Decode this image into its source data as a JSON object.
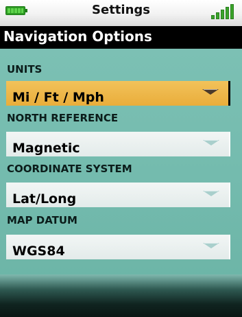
{
  "status_bar": {
    "title": "Settings",
    "battery_icon": "battery-icon",
    "signal_icon": "signal-icon"
  },
  "header": {
    "title": "Navigation Options"
  },
  "settings": [
    {
      "label": "UNITS",
      "value": "Mi / Ft / Mph",
      "selected": true
    },
    {
      "label": "NORTH REFERENCE",
      "value": "Magnetic",
      "selected": false
    },
    {
      "label": "COORDINATE SYSTEM",
      "value": "Lat/Long",
      "selected": false
    },
    {
      "label": "MAP DATUM",
      "value": "WGS84",
      "selected": false
    }
  ],
  "colors": {
    "selected_field": "#f2c25a",
    "field": "#e9efee",
    "background": "#78bdb1",
    "header_band": "#000000",
    "battery": "#5fd44c",
    "signal": "#3aa32a"
  }
}
